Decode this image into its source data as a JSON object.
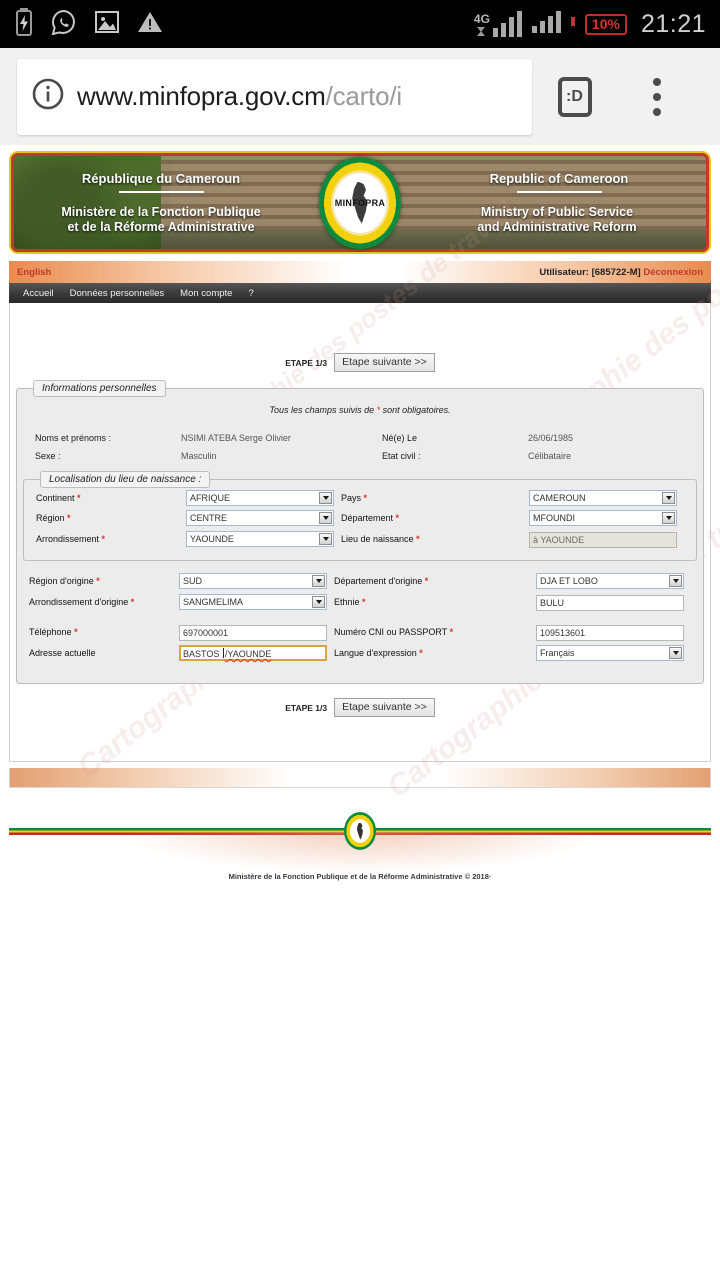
{
  "statusbar": {
    "icons": [
      "battery-charging-icon",
      "whatsapp-icon",
      "image-icon",
      "warning-icon"
    ],
    "network_label": "4G",
    "battery_percent": "10%",
    "clock": "21:21"
  },
  "browser": {
    "url_host": "www.minfopra.gov.cm",
    "url_path": "/carto/i",
    "info_icon": "site-info-icon",
    "tab_label": ":D",
    "menu_icon": "overflow-menu-icon"
  },
  "banner": {
    "fr_country": "République du Cameroun",
    "fr_ministry": "Ministère de la Fonction Publique\net de la Réforme Administrative",
    "fr_ministry_l1": "Ministère de la Fonction Publique",
    "fr_ministry_l2": "et de la Réforme Administrative",
    "en_country": "Republic of Cameroon",
    "en_ministry_l1": "Ministry of Public Service",
    "en_ministry_l2": "and Administrative Reform",
    "logo_text": "MINFOPRA"
  },
  "langbar": {
    "language_link": "English",
    "user_label": "Utilisateur: [685722-M]",
    "logout_link": "Déconnexion"
  },
  "menu": {
    "items": [
      {
        "label": "Accueil"
      },
      {
        "label": "Données personnelles"
      },
      {
        "label": "Mon compte"
      },
      {
        "label": "?"
      }
    ]
  },
  "watermark": "Cartographie des postes de travail",
  "step": {
    "label": "ETAPE 1/3",
    "next_button": "Etape suivante >>"
  },
  "personal": {
    "legend": "Informations personnelles",
    "required_note_before": "Tous les champs suivis de ",
    "required_note_star": "*",
    "required_note_after": " sont obligatoires.",
    "rows": [
      {
        "label": "Noms et prénoms :",
        "value": "NSIMI ATEBA Serge Olivier",
        "label2": "Né(e)  Le",
        "value2": "26/06/1985"
      },
      {
        "label": "Sexe :",
        "value": "Masculin",
        "label2": "Etat civil :",
        "value2": "Célibataire"
      }
    ]
  },
  "birth": {
    "legend": "Localisation du lieu de naissance :",
    "fields": [
      {
        "label": "Continent",
        "required": "*",
        "value": "AFRIQUE",
        "type": "select"
      },
      {
        "label": "Pays",
        "required": "*",
        "value": "CAMEROUN",
        "type": "select"
      },
      {
        "label": "Région",
        "required": "*",
        "value": "CENTRE",
        "type": "select"
      },
      {
        "label": "Département",
        "required": "*",
        "value": "MFOUNDI",
        "type": "select"
      },
      {
        "label": "Arrondissement",
        "required": "*",
        "value": "YAOUNDE",
        "type": "select"
      },
      {
        "label": "Lieu de naissance",
        "required": "*",
        "value": "à YAOUNDE",
        "type": "text-readonly"
      }
    ]
  },
  "origin": {
    "fields": [
      {
        "label": "Région d'origine",
        "required": "*",
        "value": "SUD",
        "type": "select"
      },
      {
        "label": "Département d'origine",
        "required": "*",
        "value": "DJA ET LOBO",
        "type": "select"
      },
      {
        "label": "Arrondissement d'origine",
        "required": "*",
        "value": "SANGMELIMA",
        "type": "select"
      },
      {
        "label": "Ethnie",
        "required": "*",
        "value": "BULU",
        "type": "text"
      },
      {
        "label": "Téléphone",
        "required": "*",
        "value": "697000001",
        "type": "text"
      },
      {
        "label": "Numéro CNI ou PASSPORT",
        "required": "*",
        "value": "109513601",
        "type": "text"
      },
      {
        "label": "Adresse actuelle",
        "required": "",
        "value": "BASTOS /YAOUNDE",
        "value_part1": "BASTOS ",
        "value_part2": "/YAOUNDE",
        "type": "text-focused"
      },
      {
        "label": "Langue d'expression",
        "required": "*",
        "value": "Français",
        "type": "select"
      }
    ]
  },
  "footer": {
    "copyright": "Ministère de la Fonction Publique et de la Réforme Administrative © 2018·"
  },
  "colors": {
    "accent_orange": "#e98b4e",
    "required_red": "#d93025",
    "link_red": "#c0392b",
    "flag_green": "#0d8a3d",
    "flag_yellow": "#f4d10c",
    "flag_red": "#c62828",
    "focus_border": "#d9a441"
  }
}
